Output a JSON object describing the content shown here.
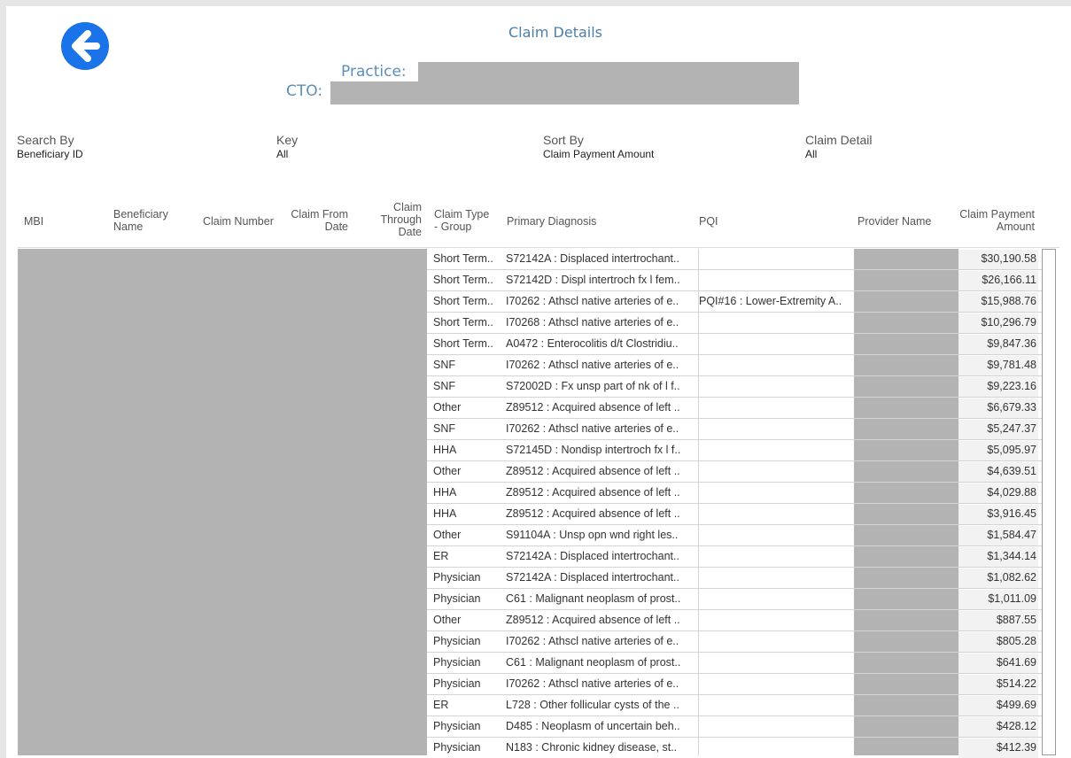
{
  "header": {
    "title": "Claim Details",
    "practice_label": "Practice:",
    "cto_label": "CTO:"
  },
  "icons": {
    "back": "back-arrow-icon"
  },
  "colors": {
    "accent": "#1a73e8",
    "title": "#4a7fa8",
    "redaction": "#b3b3b3"
  },
  "filters": [
    {
      "label": "Search By",
      "value": "Beneficiary ID"
    },
    {
      "label": "Key",
      "value": "All"
    },
    {
      "label": "Sort By",
      "value": "Claim Payment Amount"
    },
    {
      "label": "Claim Detail",
      "value": "All"
    }
  ],
  "table": {
    "columns": {
      "mbi": "MBI",
      "bene_1": "Beneficiary",
      "bene_2": "Name",
      "claim_number": "Claim Number",
      "from_1": "Claim From",
      "from_2": "Date",
      "thru_1": "Claim",
      "thru_2": "Through",
      "thru_3": "Date",
      "type_1": "Claim Type",
      "type_2": "- Group",
      "diagnosis": "Primary Diagnosis",
      "pqi": "PQI",
      "provider": "Provider Name",
      "amount_1": "Claim Payment",
      "amount_2": "Amount"
    },
    "rows": [
      {
        "type": "Short Term..",
        "diagnosis": "S72142A : Displaced intertrochant..",
        "pqi": "",
        "amount": "$30,190.58"
      },
      {
        "type": "Short Term..",
        "diagnosis": "S72142D : Displ intertroch fx l fem..",
        "pqi": "",
        "amount": "$26,166.11"
      },
      {
        "type": "Short Term..",
        "diagnosis": "I70262 : Athscl native arteries of e..",
        "pqi": "PQI#16 : Lower-Extremity A..",
        "amount": "$15,988.76"
      },
      {
        "type": "Short Term..",
        "diagnosis": "I70268 : Athscl native arteries of e..",
        "pqi": "",
        "amount": "$10,296.79"
      },
      {
        "type": "Short Term..",
        "diagnosis": "A0472 : Enterocolitis d/t Clostridiu..",
        "pqi": "",
        "amount": "$9,847.36"
      },
      {
        "type": "SNF",
        "diagnosis": "I70262 : Athscl native arteries of e..",
        "pqi": "",
        "amount": "$9,781.48"
      },
      {
        "type": "SNF",
        "diagnosis": "S72002D : Fx unsp part of nk of l f..",
        "pqi": "",
        "amount": "$9,223.16"
      },
      {
        "type": "Other",
        "diagnosis": "Z89512 : Acquired absence of left ..",
        "pqi": "",
        "amount": "$6,679.33"
      },
      {
        "type": "SNF",
        "diagnosis": "I70262 : Athscl native arteries of e..",
        "pqi": "",
        "amount": "$5,247.37"
      },
      {
        "type": "HHA",
        "diagnosis": "S72145D : Nondisp intertroch fx l f..",
        "pqi": "",
        "amount": "$5,095.97"
      },
      {
        "type": "Other",
        "diagnosis": "Z89512 : Acquired absence of left ..",
        "pqi": "",
        "amount": "$4,639.51"
      },
      {
        "type": "HHA",
        "diagnosis": "Z89512 : Acquired absence of left ..",
        "pqi": "",
        "amount": "$4,029.88"
      },
      {
        "type": "HHA",
        "diagnosis": "Z89512 : Acquired absence of left ..",
        "pqi": "",
        "amount": "$3,916.45"
      },
      {
        "type": "Other",
        "diagnosis": "S91104A : Unsp opn wnd right les..",
        "pqi": "",
        "amount": "$1,584.47"
      },
      {
        "type": "ER",
        "diagnosis": "S72142A : Displaced intertrochant..",
        "pqi": "",
        "amount": "$1,344.14"
      },
      {
        "type": "Physician",
        "diagnosis": "S72142A : Displaced intertrochant..",
        "pqi": "",
        "amount": "$1,082.62"
      },
      {
        "type": "Physician",
        "diagnosis": "C61 : Malignant neoplasm of prost..",
        "pqi": "",
        "amount": "$1,011.09"
      },
      {
        "type": "Other",
        "diagnosis": "Z89512 : Acquired absence of left ..",
        "pqi": "",
        "amount": "$887.55"
      },
      {
        "type": "Physician",
        "diagnosis": "I70262 : Athscl native arteries of e..",
        "pqi": "",
        "amount": "$805.28"
      },
      {
        "type": "Physician",
        "diagnosis": "C61 : Malignant neoplasm of prost..",
        "pqi": "",
        "amount": "$641.69"
      },
      {
        "type": "Physician",
        "diagnosis": "I70262 : Athscl native arteries of e..",
        "pqi": "",
        "amount": "$514.22"
      },
      {
        "type": "ER",
        "diagnosis": "L728 : Other follicular cysts of the ..",
        "pqi": "",
        "amount": "$499.69"
      },
      {
        "type": "Physician",
        "diagnosis": "D485 : Neoplasm of uncertain beh..",
        "pqi": "",
        "amount": "$428.12"
      },
      {
        "type": "Physician",
        "diagnosis": "N183 : Chronic kidney disease, st..",
        "pqi": "",
        "amount": "$412.39"
      }
    ]
  }
}
